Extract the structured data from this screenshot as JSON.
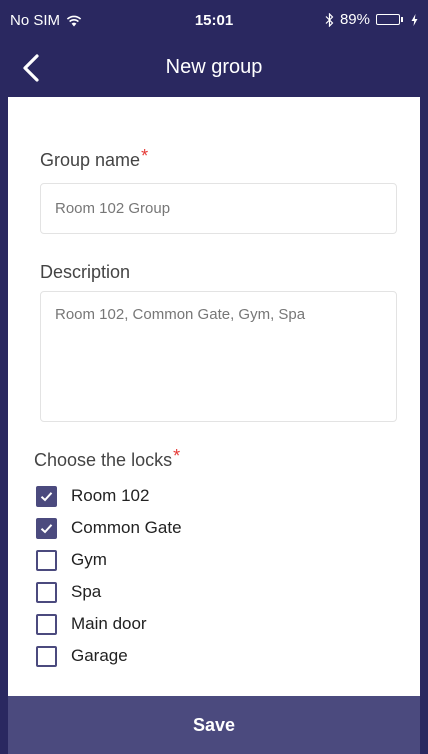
{
  "status_bar": {
    "carrier": "No SIM",
    "time": "15:01",
    "battery_percent": "89%",
    "battery_level": 0.89,
    "icons": [
      "wifi-icon",
      "bluetooth-icon",
      "battery-icon",
      "charging-icon"
    ]
  },
  "nav": {
    "title": "New group",
    "back_icon": "chevron-left-icon"
  },
  "form": {
    "group_name": {
      "label": "Group name",
      "required_mark": "*",
      "value": "Room 102 Group"
    },
    "description": {
      "label": "Description",
      "value": "Room 102, Common Gate, Gym, Spa"
    },
    "locks": {
      "label": "Choose the locks",
      "required_mark": "*",
      "items": [
        {
          "label": "Room 102",
          "checked": true
        },
        {
          "label": "Common Gate",
          "checked": true
        },
        {
          "label": "Gym",
          "checked": false
        },
        {
          "label": "Spa",
          "checked": false
        },
        {
          "label": "Main door",
          "checked": false
        },
        {
          "label": "Garage",
          "checked": false
        }
      ]
    }
  },
  "footer": {
    "save_label": "Save"
  },
  "colors": {
    "header": "#2a2860",
    "accent": "#4b4a7e",
    "required": "#e53935",
    "battery": "#35d14a"
  }
}
